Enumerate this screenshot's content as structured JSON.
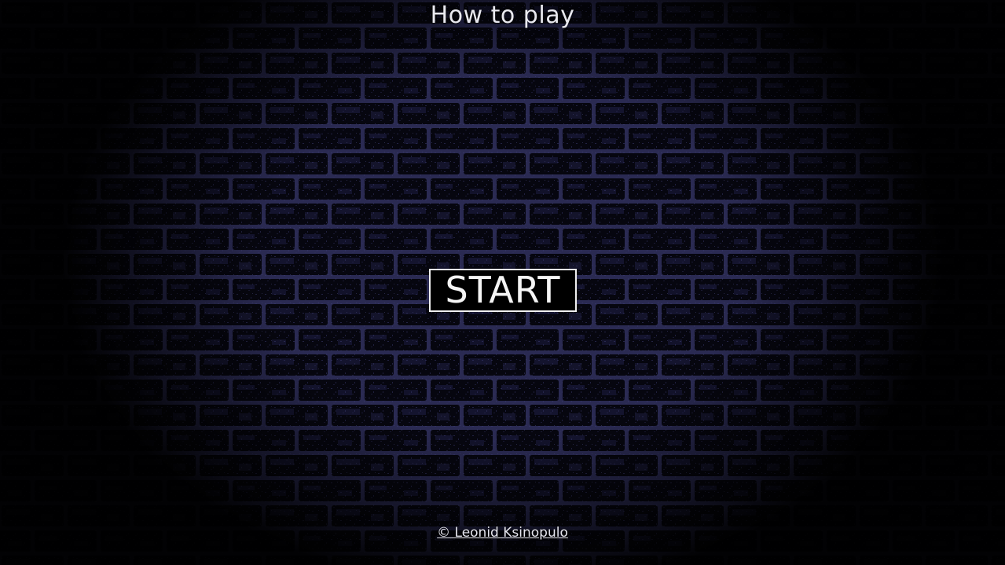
{
  "menu": {
    "how_to_play_label": "How to play",
    "start_label": "START",
    "copyright_text": "© Leonid Ksinopulo"
  },
  "background": {
    "icon": "brick-wall-texture",
    "mortar_color": "#2b2b55",
    "brick_color": "#050510",
    "light_brick_color": "#1b1b40"
  }
}
